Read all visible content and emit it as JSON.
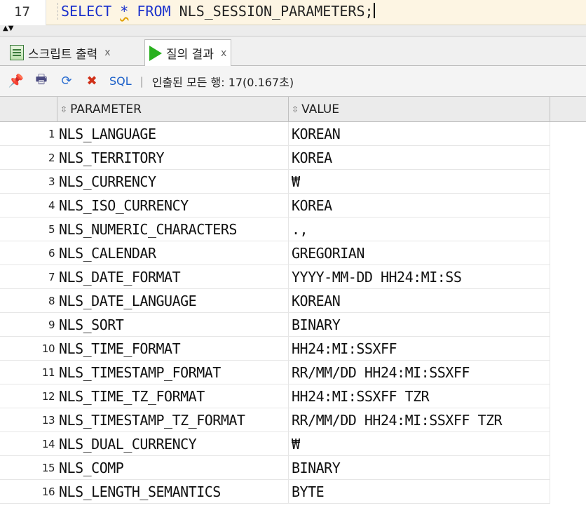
{
  "editor": {
    "line_number": "17",
    "kw_select": "SELECT",
    "star": "*",
    "kw_from": "FROM",
    "table": "NLS_SESSION_PARAMETERS;"
  },
  "tabs": [
    {
      "label": "스크립트 출력",
      "close": "x"
    },
    {
      "label": "질의 결과",
      "close": "x"
    }
  ],
  "toolbar": {
    "sql_label": "SQL",
    "separator": "|",
    "status": "인출된 모든 행: 17(0.167초)"
  },
  "grid": {
    "columns": [
      "PARAMETER",
      "VALUE"
    ],
    "rows": [
      {
        "n": "1",
        "param": "NLS_LANGUAGE",
        "value": "KOREAN"
      },
      {
        "n": "2",
        "param": "NLS_TERRITORY",
        "value": "KOREA"
      },
      {
        "n": "3",
        "param": "NLS_CURRENCY",
        "value": "₩"
      },
      {
        "n": "4",
        "param": "NLS_ISO_CURRENCY",
        "value": "KOREA"
      },
      {
        "n": "5",
        "param": "NLS_NUMERIC_CHARACTERS",
        "value": ".,"
      },
      {
        "n": "6",
        "param": "NLS_CALENDAR",
        "value": "GREGORIAN"
      },
      {
        "n": "7",
        "param": "NLS_DATE_FORMAT",
        "value": "YYYY-MM-DD HH24:MI:SS"
      },
      {
        "n": "8",
        "param": "NLS_DATE_LANGUAGE",
        "value": "KOREAN"
      },
      {
        "n": "9",
        "param": "NLS_SORT",
        "value": "BINARY"
      },
      {
        "n": "10",
        "param": "NLS_TIME_FORMAT",
        "value": "HH24:MI:SSXFF"
      },
      {
        "n": "11",
        "param": "NLS_TIMESTAMP_FORMAT",
        "value": "RR/MM/DD HH24:MI:SSXFF"
      },
      {
        "n": "12",
        "param": "NLS_TIME_TZ_FORMAT",
        "value": "HH24:MI:SSXFF TZR"
      },
      {
        "n": "13",
        "param": "NLS_TIMESTAMP_TZ_FORMAT",
        "value": "RR/MM/DD HH24:MI:SSXFF TZR"
      },
      {
        "n": "14",
        "param": "NLS_DUAL_CURRENCY",
        "value": "₩"
      },
      {
        "n": "15",
        "param": "NLS_COMP",
        "value": "BINARY"
      },
      {
        "n": "16",
        "param": "NLS_LENGTH_SEMANTICS",
        "value": "BYTE"
      }
    ]
  },
  "icons": {
    "script_tab": "script-output-icon",
    "result_tab": "play-icon",
    "pin": "pin-icon",
    "print": "print-icon",
    "refresh": "refresh-icon",
    "cancel": "cancel-icon",
    "sort": "sort-icon"
  }
}
